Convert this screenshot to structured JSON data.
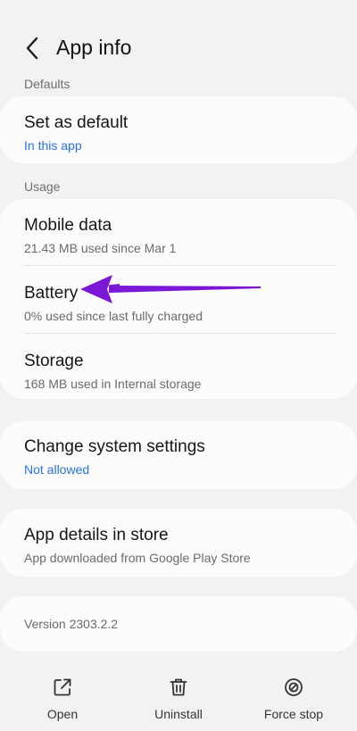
{
  "header": {
    "title": "App info",
    "back_icon": "chevron-left-icon"
  },
  "sections": {
    "defaults_label": "Defaults",
    "usage_label": "Usage"
  },
  "defaults": {
    "set_default_title": "Set as default",
    "set_default_sub": "In this app"
  },
  "usage": {
    "mobile_title": "Mobile data",
    "mobile_sub": "21.43 MB used since Mar 1",
    "battery_title": "Battery",
    "battery_sub": "0% used since last fully charged",
    "storage_title": "Storage",
    "storage_sub": "168 MB used in Internal storage"
  },
  "system": {
    "change_title": "Change system settings",
    "change_sub": "Not allowed"
  },
  "store": {
    "details_title": "App details in store",
    "details_sub": "App downloaded from Google Play Store"
  },
  "version": "Version 2303.2.2",
  "bottom": {
    "open_label": "Open",
    "uninstall_label": "Uninstall",
    "force_stop_label": "Force stop"
  },
  "colors": {
    "accent_blue": "#2a6fdb",
    "annotation_arrow": "#7b17d6",
    "background": "#f2f2f4",
    "card": "#fcfcfc"
  }
}
